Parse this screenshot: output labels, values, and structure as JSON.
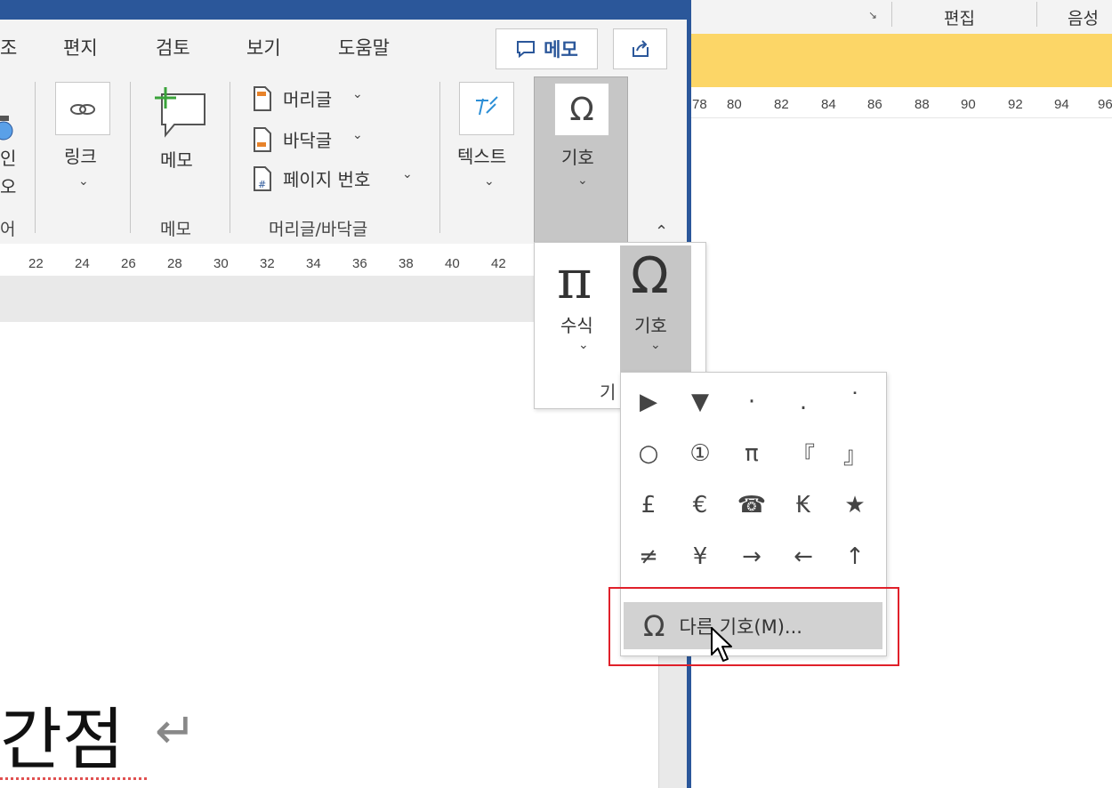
{
  "background_window": {
    "header_groups": [
      "편집",
      "음성"
    ],
    "ruler_numbers": [
      "78",
      "80",
      "82",
      "84",
      "86",
      "88",
      "90",
      "92",
      "94",
      "96"
    ]
  },
  "ribbon": {
    "tabs": [
      "조",
      "편지",
      "검토",
      "보기",
      "도움말"
    ],
    "memo_button": "메모",
    "link_group": {
      "left_partial": [
        "인",
        "오"
      ],
      "left_group_partial": "어",
      "link_label": "링크"
    },
    "comment_group": {
      "button_label": "메모",
      "group_label": "메모"
    },
    "header_footer_group": {
      "items": [
        "머리글",
        "바닥글",
        "페이지 번호"
      ],
      "group_label": "머리글/바닥글"
    },
    "text_label": "텍스트",
    "symbol_label": "기호"
  },
  "doc_ruler": [
    "22",
    "24",
    "26",
    "28",
    "30",
    "32",
    "34",
    "36",
    "38",
    "40",
    "42"
  ],
  "symbols_panel": {
    "equation_label": "수식",
    "symbol_label": "기호",
    "group_label_partial": "기"
  },
  "symbol_gallery": {
    "symbols": [
      "▶",
      "▼",
      "·",
      ".",
      "˙",
      "○",
      "①",
      "π",
      "『",
      "』",
      "£",
      "€",
      "☎",
      "₭",
      "★",
      "≠",
      "¥",
      "→",
      "←",
      "↑"
    ],
    "more_label": "다른 기호(M)..."
  },
  "document": {
    "text": "간점",
    "return_mark": "↵"
  },
  "colors": {
    "accent": "#2b579a",
    "highlight_box": "#e0202a",
    "yellow_band": "#fcd667"
  }
}
